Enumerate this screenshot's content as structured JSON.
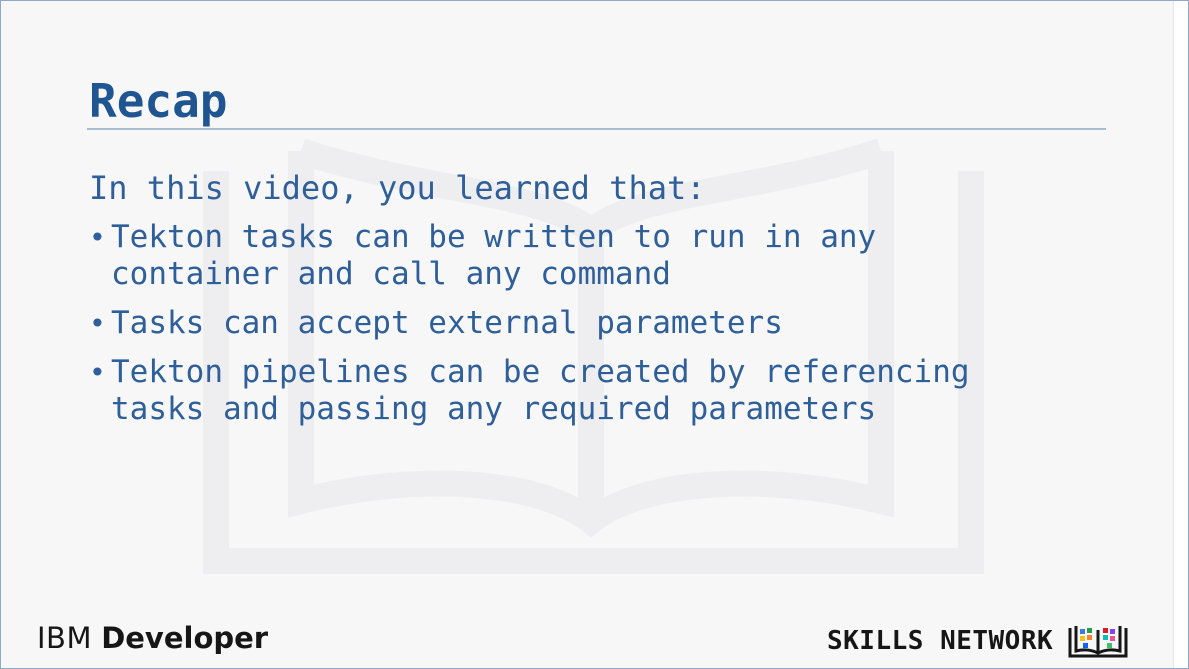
{
  "slide": {
    "title": "Recap",
    "intro": "In this video, you learned that:",
    "bullets": [
      "Tekton tasks can be written to run in any\ncontainer and call any command",
      "Tasks can accept external parameters",
      "Tekton pipelines can be created by referencing\ntasks and passing any required parameters"
    ],
    "bullet_glyph": "•"
  },
  "footer": {
    "left_logo": {
      "brand": "IBM",
      "product": "Developer"
    },
    "right_logo": {
      "text": "SKILLS NETWORK",
      "icon": "open-book-icon"
    }
  },
  "colors": {
    "title": "#1f5590",
    "body_text": "#2f5f99",
    "rule": "#a9bdd2",
    "logo_text": "#161616"
  }
}
